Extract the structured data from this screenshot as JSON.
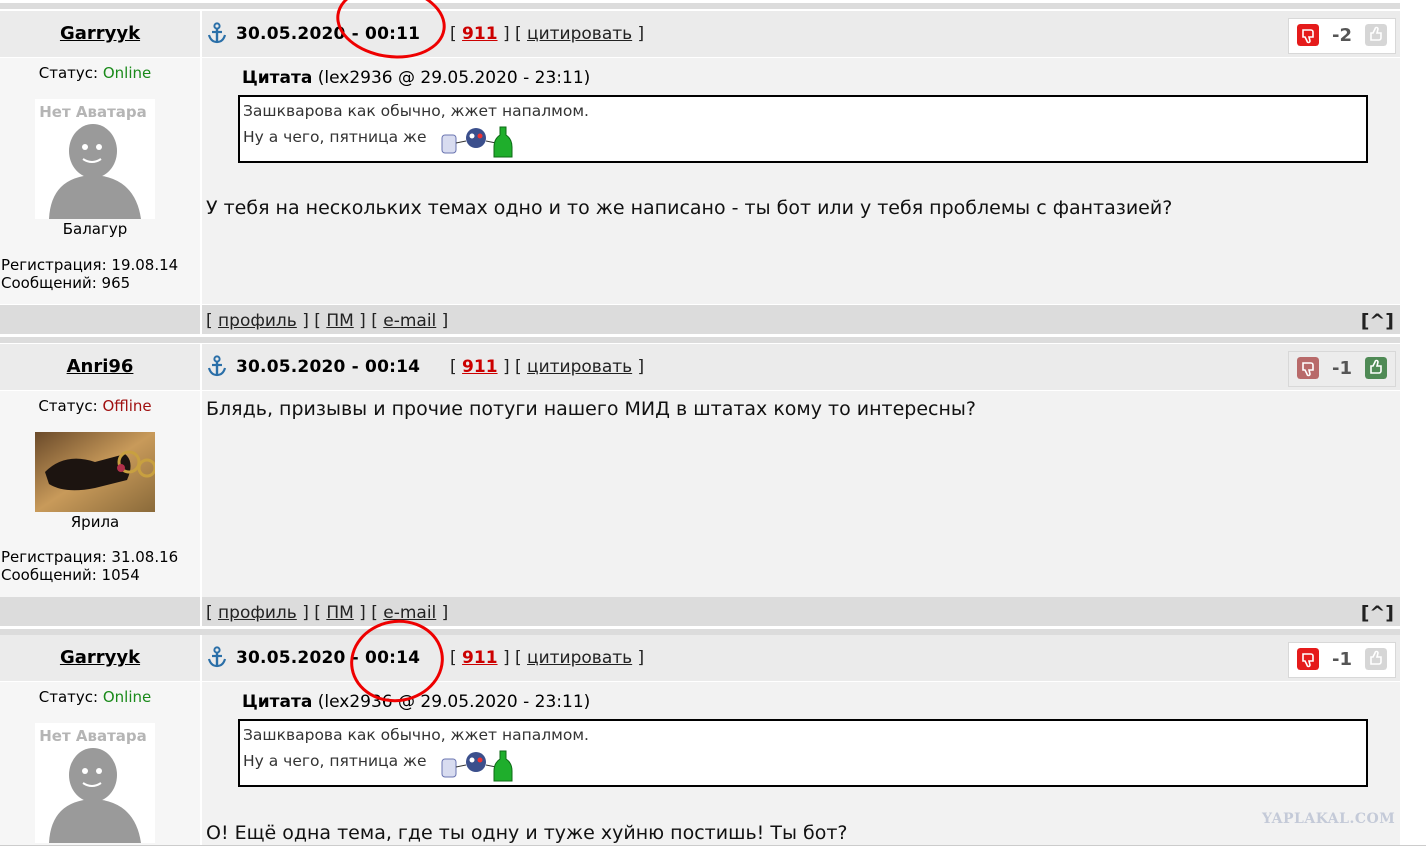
{
  "posts": [
    {
      "username": "Garryyk",
      "datetime": "30.05.2020 - 00:11",
      "link_911": "911",
      "quote_link": "цитировать",
      "score": "-2",
      "status_label": "Статус:",
      "status_value": "Online",
      "avatar_text": "Нет Аватара",
      "rank": "Балагур",
      "reg": "Регистрация: 19.08.14",
      "msgs": "Сообщений: 965",
      "quote_head": "Цитата",
      "quote_meta": "(lex2936 @ 29.05.2020 - 23:11)",
      "quote_line1": "Зашкварова как обычно, жжет напалмом.",
      "quote_line2": "Ну а чего, пятница же",
      "message": "У тебя на нескольких темах одно и то же написано - ты бот или у тебя проблемы с фантазией?"
    },
    {
      "username": "Anri96",
      "datetime": "30.05.2020 - 00:14",
      "link_911": "911",
      "quote_link": "цитировать",
      "score": "-1",
      "status_label": "Статус:",
      "status_value": "Offline",
      "rank": "Ярила",
      "reg": "Регистрация: 31.08.16",
      "msgs": "Сообщений: 1054",
      "message": "Блядь, призывы и прочие потуги нашего МИД в штатах кому то интересны?"
    },
    {
      "username": "Garryyk",
      "datetime": "30.05.2020 - 00:14",
      "link_911": "911",
      "quote_link": "цитировать",
      "score": "-1",
      "status_label": "Статус:",
      "status_value": "Online",
      "avatar_text": "Нет Аватара",
      "quote_head": "Цитата",
      "quote_meta": "(lex2936 @ 29.05.2020 - 23:11)",
      "quote_line1": "Зашкварова как обычно, жжет напалмом.",
      "quote_line2": "Ну а чего, пятница же",
      "message": "О! Ещё одна тема, где ты одну и туже хуйню постишь! Ты бот?"
    }
  ],
  "footer": {
    "profile": "профиль",
    "pm": "ПМ",
    "email": "e-mail",
    "top": "[^]"
  },
  "watermark": "YAPLAKAL.COM",
  "colors": {
    "online": "#1a8a1a",
    "offline": "#a01010",
    "link911": "#cc0000",
    "annotation_circle": "#ee0000"
  },
  "icons": [
    "anchor-icon",
    "thumb-down-icon",
    "thumb-up-icon",
    "smiley-icon"
  ]
}
